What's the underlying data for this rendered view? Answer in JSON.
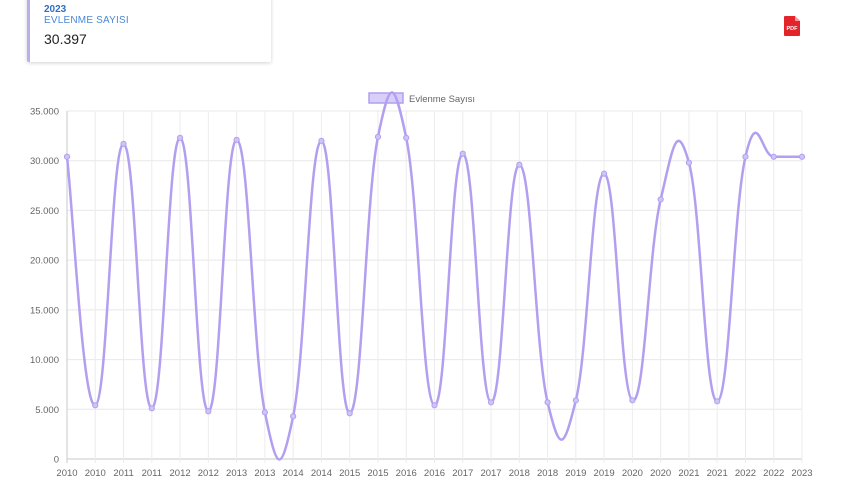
{
  "card": {
    "year": "2023",
    "label": "EVLENME SAYISI",
    "value": "30.397"
  },
  "pdf_button": {
    "icon": "pdf-icon",
    "label": "PDF",
    "color": "#e3252b"
  },
  "chart_data": {
    "type": "line",
    "legend": {
      "label": "Evlenme Sayısı",
      "position": "top"
    },
    "x": [
      "2010",
      "2010",
      "2011",
      "2011",
      "2012",
      "2012",
      "2013",
      "2013",
      "2014",
      "2014",
      "2015",
      "2015",
      "2016",
      "2016",
      "2017",
      "2017",
      "2018",
      "2018",
      "2019",
      "2019",
      "2020",
      "2020",
      "2021",
      "2021",
      "2022",
      "2022",
      "2023"
    ],
    "series": [
      {
        "name": "Evlenme Sayısı",
        "color": "#b39ff0",
        "values": [
          30400,
          5400,
          31700,
          5100,
          32300,
          4800,
          32100,
          4700,
          4300,
          32000,
          4600,
          32400,
          32300,
          5400,
          30700,
          5700,
          29600,
          5700,
          5900,
          28700,
          5900,
          26100,
          29800,
          5800,
          30400,
          30397,
          30397
        ]
      }
    ],
    "ylim": [
      0,
      35000
    ],
    "yticks": [
      "0",
      "5.000",
      "10.000",
      "15.000",
      "20.000",
      "25.000",
      "30.000",
      "35.000"
    ],
    "grid": true
  }
}
